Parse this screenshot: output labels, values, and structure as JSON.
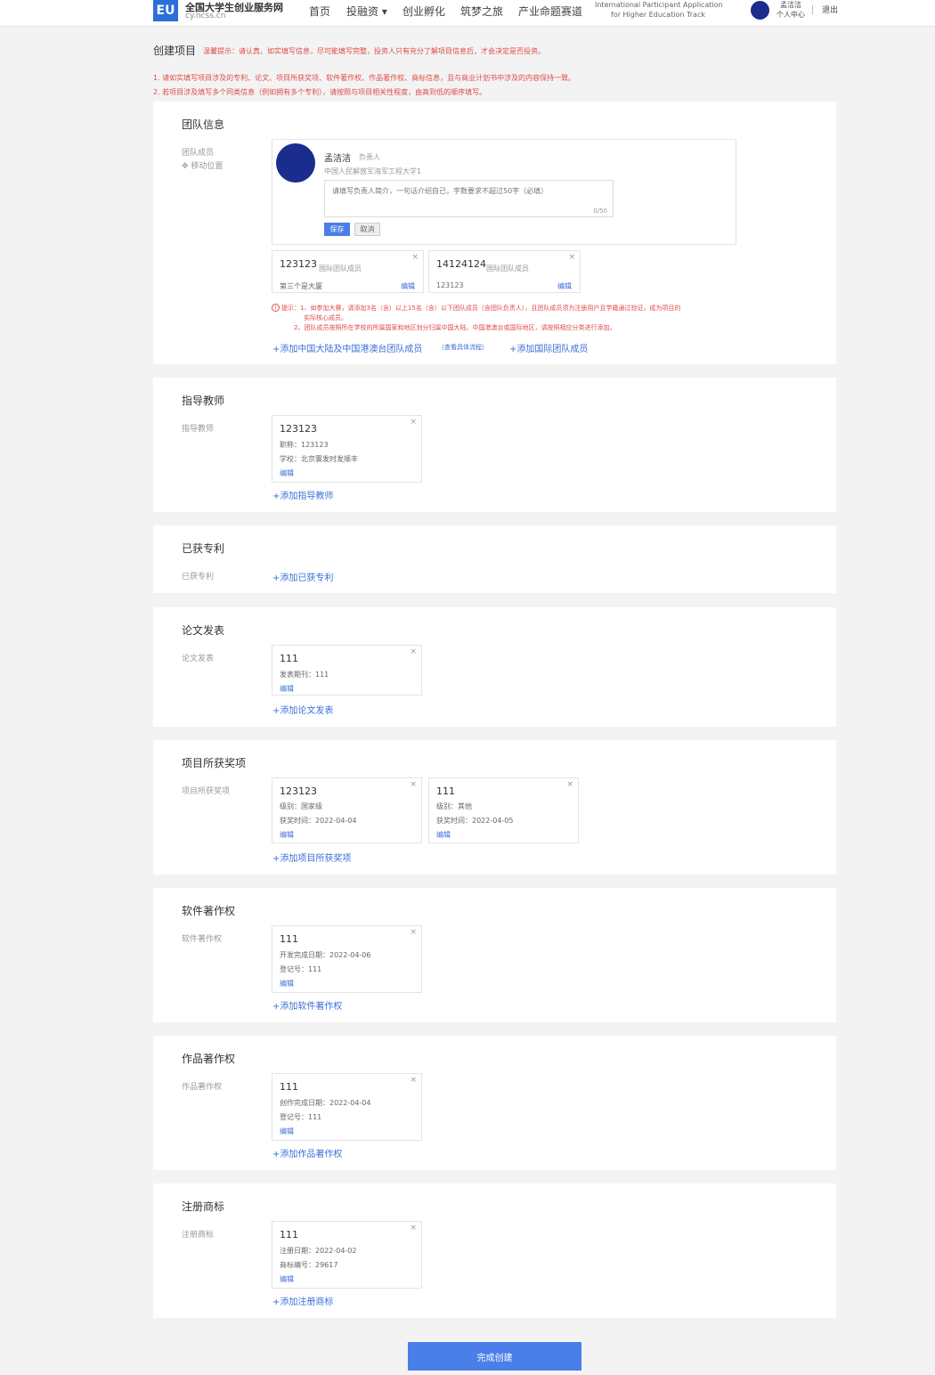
{
  "header": {
    "logo_glyph": "EU",
    "site_name": "全国大学生创业服务网",
    "site_domain": "cy.ncss.cn",
    "nav": [
      "首页",
      "投融资 ▾",
      "创业孵化",
      "筑梦之旅",
      "产业命题赛道"
    ],
    "intl_track_line1": "International Participant Application",
    "intl_track_line2": "for Higher Education Track",
    "user_name": "孟洁洁",
    "user_center": "个人中心",
    "logout": "退出"
  },
  "intro": {
    "page_title": "创建项目",
    "tip": "温馨提示：请认真、如实填写信息，尽可能填写完整，投资人只有充分了解项目信息后，才会决定是否投资。",
    "note1": "1. 请如实填写项目涉及的专利、论文、项目所获奖项、软件著作权、作品著作权、商标信息，且与商业计划书中涉及的内容保持一致。",
    "note2": "2. 若项目涉及填写多个同类信息（例如拥有多个专利），请按照与项目相关性程度，由高到低的顺序填写。"
  },
  "team": {
    "title": "团队信息",
    "label": "团队成员",
    "move": "✥ 移动位置",
    "leader": {
      "name": "孟洁洁",
      "role": "负责人",
      "school": "中国人民解放军海军工程大学1",
      "placeholder": "请填写负责人简介，一句话介绍自己，字数要求不超过50字（必填）",
      "count": "0/50",
      "save": "保存",
      "cancel": "取消"
    },
    "members": [
      {
        "name": "123123",
        "role": "国际团队成员",
        "sub": "第三个是大厦",
        "edit": "编辑"
      },
      {
        "name": "14124124",
        "role": "国际团队成员",
        "sub": "123123",
        "edit": "编辑"
      }
    ],
    "hint1": "提示：1、如参加大赛，请添加3名（含）以上15名（含）以下团队成员（含团队负责人），且团队成员须为注册用户且学籍通过验证，成为项目的",
    "hint1b": "实际核心成员。",
    "hint2": "2、团队成员按照所在学校的所属国家和地区划分归属中国大陆、中国港澳台或国际地区，请按照相应分类进行添加。",
    "add_cn": "+添加中国大陆及中国港澳台团队成员",
    "add_cn_note": "（查看具体流程）",
    "add_intl": "+添加国际团队成员"
  },
  "advisor": {
    "title": "指导教师",
    "label": "指导教师",
    "card": {
      "title": "123123",
      "line1": "职称：123123",
      "line2": "学校：北京寰发时发顺丰",
      "edit": "编辑"
    },
    "add": "+添加指导教师"
  },
  "patent": {
    "title": "已获专利",
    "label": "已获专利",
    "add": "+添加已获专利"
  },
  "paper": {
    "title": "论文发表",
    "label": "论文发表",
    "card": {
      "title": "111",
      "line1": "发表期刊：111",
      "edit": "编辑"
    },
    "add": "+添加论文发表"
  },
  "award": {
    "title": "项目所获奖项",
    "label": "项目所获奖项",
    "cards": [
      {
        "title": "123123",
        "line1": "级别：国家级",
        "line2": "获奖时间：2022-04-04",
        "edit": "编辑"
      },
      {
        "title": "111",
        "line1": "级别：其他",
        "line2": "获奖时间：2022-04-05",
        "edit": "编辑"
      }
    ],
    "add": "+添加项目所获奖项"
  },
  "software": {
    "title": "软件著作权",
    "label": "软件著作权",
    "card": {
      "title": "111",
      "line1": "开发完成日期：2022-04-06",
      "line2": "登记号：111",
      "edit": "编辑"
    },
    "add": "+添加软件著作权"
  },
  "works": {
    "title": "作品著作权",
    "label": "作品著作权",
    "card": {
      "title": "111",
      "line1": "创作完成日期：2022-04-04",
      "line2": "登记号：111",
      "edit": "编辑"
    },
    "add": "+添加作品著作权"
  },
  "trademark": {
    "title": "注册商标",
    "label": "注册商标",
    "card": {
      "title": "111",
      "line1": "注册日期：2022-04-02",
      "line2": "商标编号：29617",
      "edit": "编辑"
    },
    "add": "+添加注册商标"
  },
  "submit": "完成创建",
  "close_glyph": "×",
  "colors": {
    "accent": "#4a7ee8",
    "link": "#3a6fd8",
    "warning": "#e04a4a",
    "avatar": "#1a2d8f"
  }
}
